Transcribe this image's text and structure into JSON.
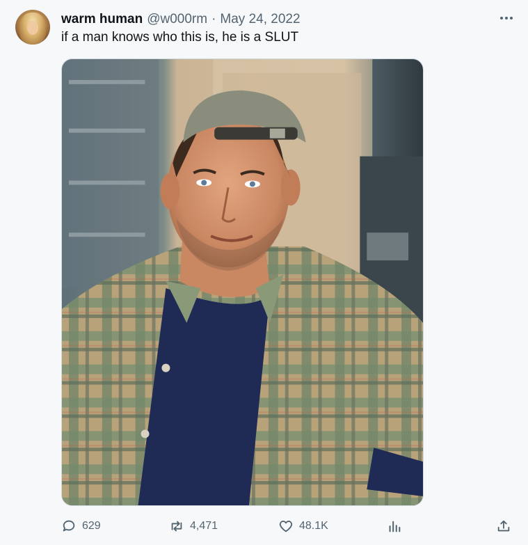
{
  "tweet": {
    "author_name": "warm human",
    "author_handle": "@w000rm",
    "separator": "·",
    "date": "May 24, 2022",
    "text": "if a man knows who this is, he is a SLUT"
  },
  "actions": {
    "replies": "629",
    "retweets": "4,471",
    "likes": "48.1K"
  },
  "icons": [
    "avatar",
    "more-icon",
    "reply-icon",
    "retweet-icon",
    "like-icon",
    "views-icon",
    "share-icon"
  ],
  "colors": {
    "text_primary": "#0f1419",
    "text_secondary": "#536471",
    "background": "#f7f8f9"
  }
}
